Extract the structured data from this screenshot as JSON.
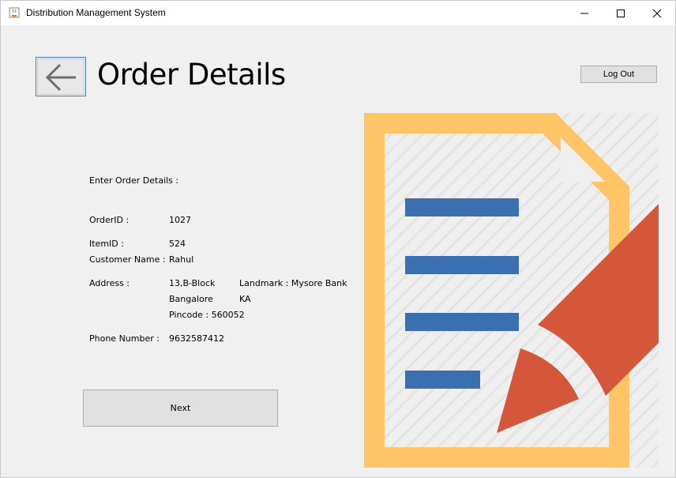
{
  "window": {
    "title": "Distribution Management System"
  },
  "header": {
    "title": "Order Details",
    "logout_label": "Log Out"
  },
  "form": {
    "heading": "Enter Order Details :",
    "order_id_label": "OrderID :",
    "order_id_value": "1027",
    "item_id_label": "ItemID :",
    "item_id_value": "524",
    "customer_name_label": "Customer Name :",
    "customer_name_value": "Rahul",
    "address_label": "Address :",
    "address_line1": "13,B-Block",
    "address_city": "Bangalore",
    "pincode": "Pincode : 560052",
    "landmark": "Landmark : Mysore Bank",
    "state": "KA",
    "phone_label": "Phone Number :",
    "phone_value": "9632587412",
    "next_label": "Next"
  },
  "icons": {
    "back": "arrow-left-icon",
    "app": "java-cup-icon",
    "illustration": "document-edit-icon"
  },
  "colors": {
    "document_frame": "#ffc567",
    "document_lines": "#3a6fb0",
    "pencil": "#d5573b",
    "background": "#f0f0f0"
  }
}
